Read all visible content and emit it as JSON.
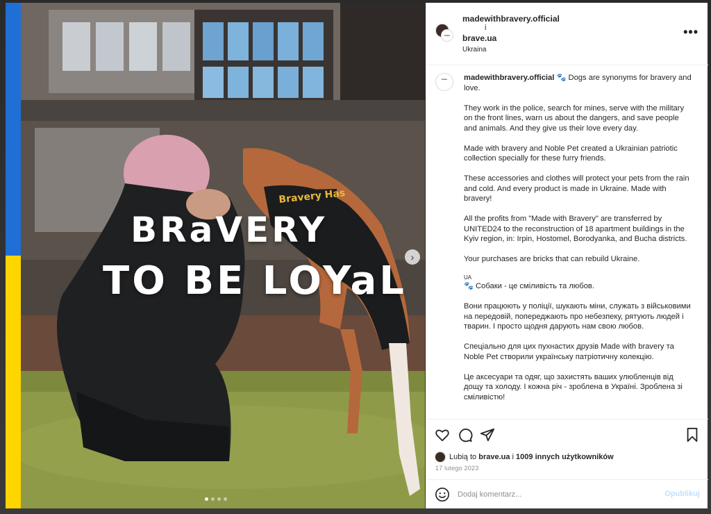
{
  "post": {
    "overlay_line1": "BRaVERY",
    "overlay_line2": "TO BE LOYaL",
    "dog_coat_text": "Bravery Has"
  },
  "header": {
    "user1": "madewithbravery.official",
    "and": "i",
    "user2": "brave.ua",
    "location": "Ukraina",
    "more_icon": "more-horizontal-icon"
  },
  "caption": {
    "username": "madewithbravery.official",
    "paragraphs": [
      "🐾 Dogs are synonyms for bravery and love.",
      "They work in the police, search for mines, serve with the military on the front lines, warn us about the dangers, and save people and animals. And they give us their love every day.",
      "Made with bravery and Noble Pet created a Ukrainian patriotic collection specially for these furry friends.",
      "These accessories and clothes will protect your pets from the rain and cold. And every product is made in Ukraine. Made with bravery!",
      "All the profits from \"Made with Bravery\" are transferred by UNITED24 to the reconstruction of 18 apartment buildings in the Kyiv region, in: Irpin, Hostomel, Borodyanka, and Bucha districts.",
      "Your purchases are bricks that can rebuild Ukraine."
    ],
    "ua_label": "UA",
    "ua_paragraphs": [
      "🐾 Собаки - це сміливість та любов.",
      "Вони працюють у поліції, шукають міни, служать з військовими на передовій, попереджають про небезпеку, рятують людей і тварин. І просто щодня дарують нам свою любов.",
      "Спеціально для цих пухнастих друзів Made with bravery та Noble Pet створили українську патріотичну колекцію.",
      "Це аксесуари та одяг, що захистять ваших улюбленців від дощу та холоду. І кожна річ - зроблена в Україні. Зроблена зі сміливістю!"
    ]
  },
  "actions": {
    "likes_prefix": "Lubią to",
    "likes_user": "brave.ua",
    "likes_and": "i",
    "likes_others": "1009 innych użytkowników",
    "date": "17 lutego 2023"
  },
  "comment": {
    "placeholder": "Dodaj komentarz...",
    "publish_label": "Opublikuj"
  },
  "colors": {
    "flag_blue": "#1f6fd6",
    "flag_yellow": "#ffd500",
    "publish_disabled": "#c0dffd"
  }
}
